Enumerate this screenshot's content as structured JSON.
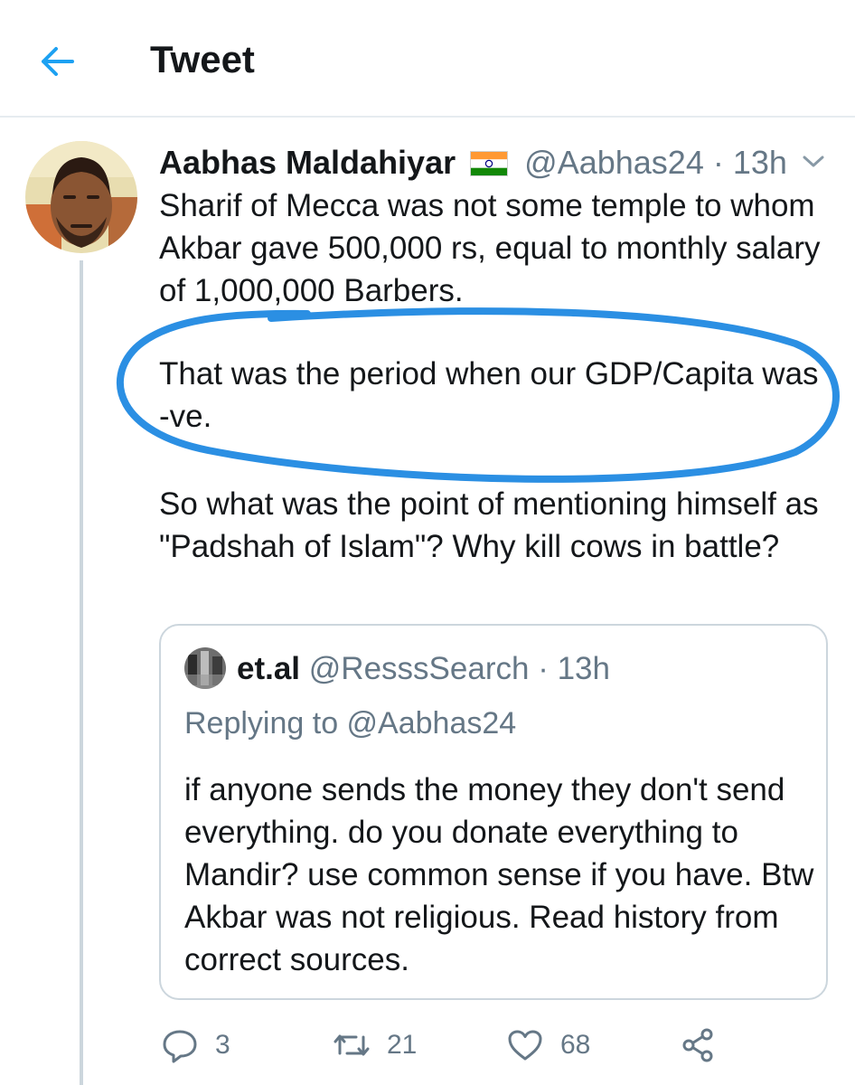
{
  "header": {
    "title": "Tweet",
    "back_icon": "arrow-left-icon",
    "accent": "#1da1f2"
  },
  "tweet": {
    "author_name": "Aabhas Maldahiyar",
    "flag_icon": "india-flag-icon",
    "handle": "@Aabhas24",
    "separator": "·",
    "time": "13h",
    "paragraphs": [
      "Sharif of Mecca was not some temple to whom Akbar gave 500,000 rs, equal to monthly salary of 1,000,000 Barbers.",
      "That was the period when our GDP/Capita was -ve.",
      "So what was the point of mentioning himself as \"Padshah of Islam\"? Why kill cows in battle?"
    ],
    "annotation_color": "#2b8fe3"
  },
  "quoted": {
    "author_name": "et.al",
    "handle": "@ResssSearch",
    "separator": "·",
    "time": "13h",
    "replying_to": "Replying to @Aabhas24",
    "text": "if anyone sends the money they don't send everything. do you donate everything to Mandir? use common sense if you have. Btw Akbar was not religious. Read history from correct sources."
  },
  "actions": {
    "reply_count": "3",
    "retweet_count": "21",
    "like_count": "68",
    "icons": [
      "reply-icon",
      "retweet-icon",
      "like-icon",
      "share-icon"
    ]
  }
}
